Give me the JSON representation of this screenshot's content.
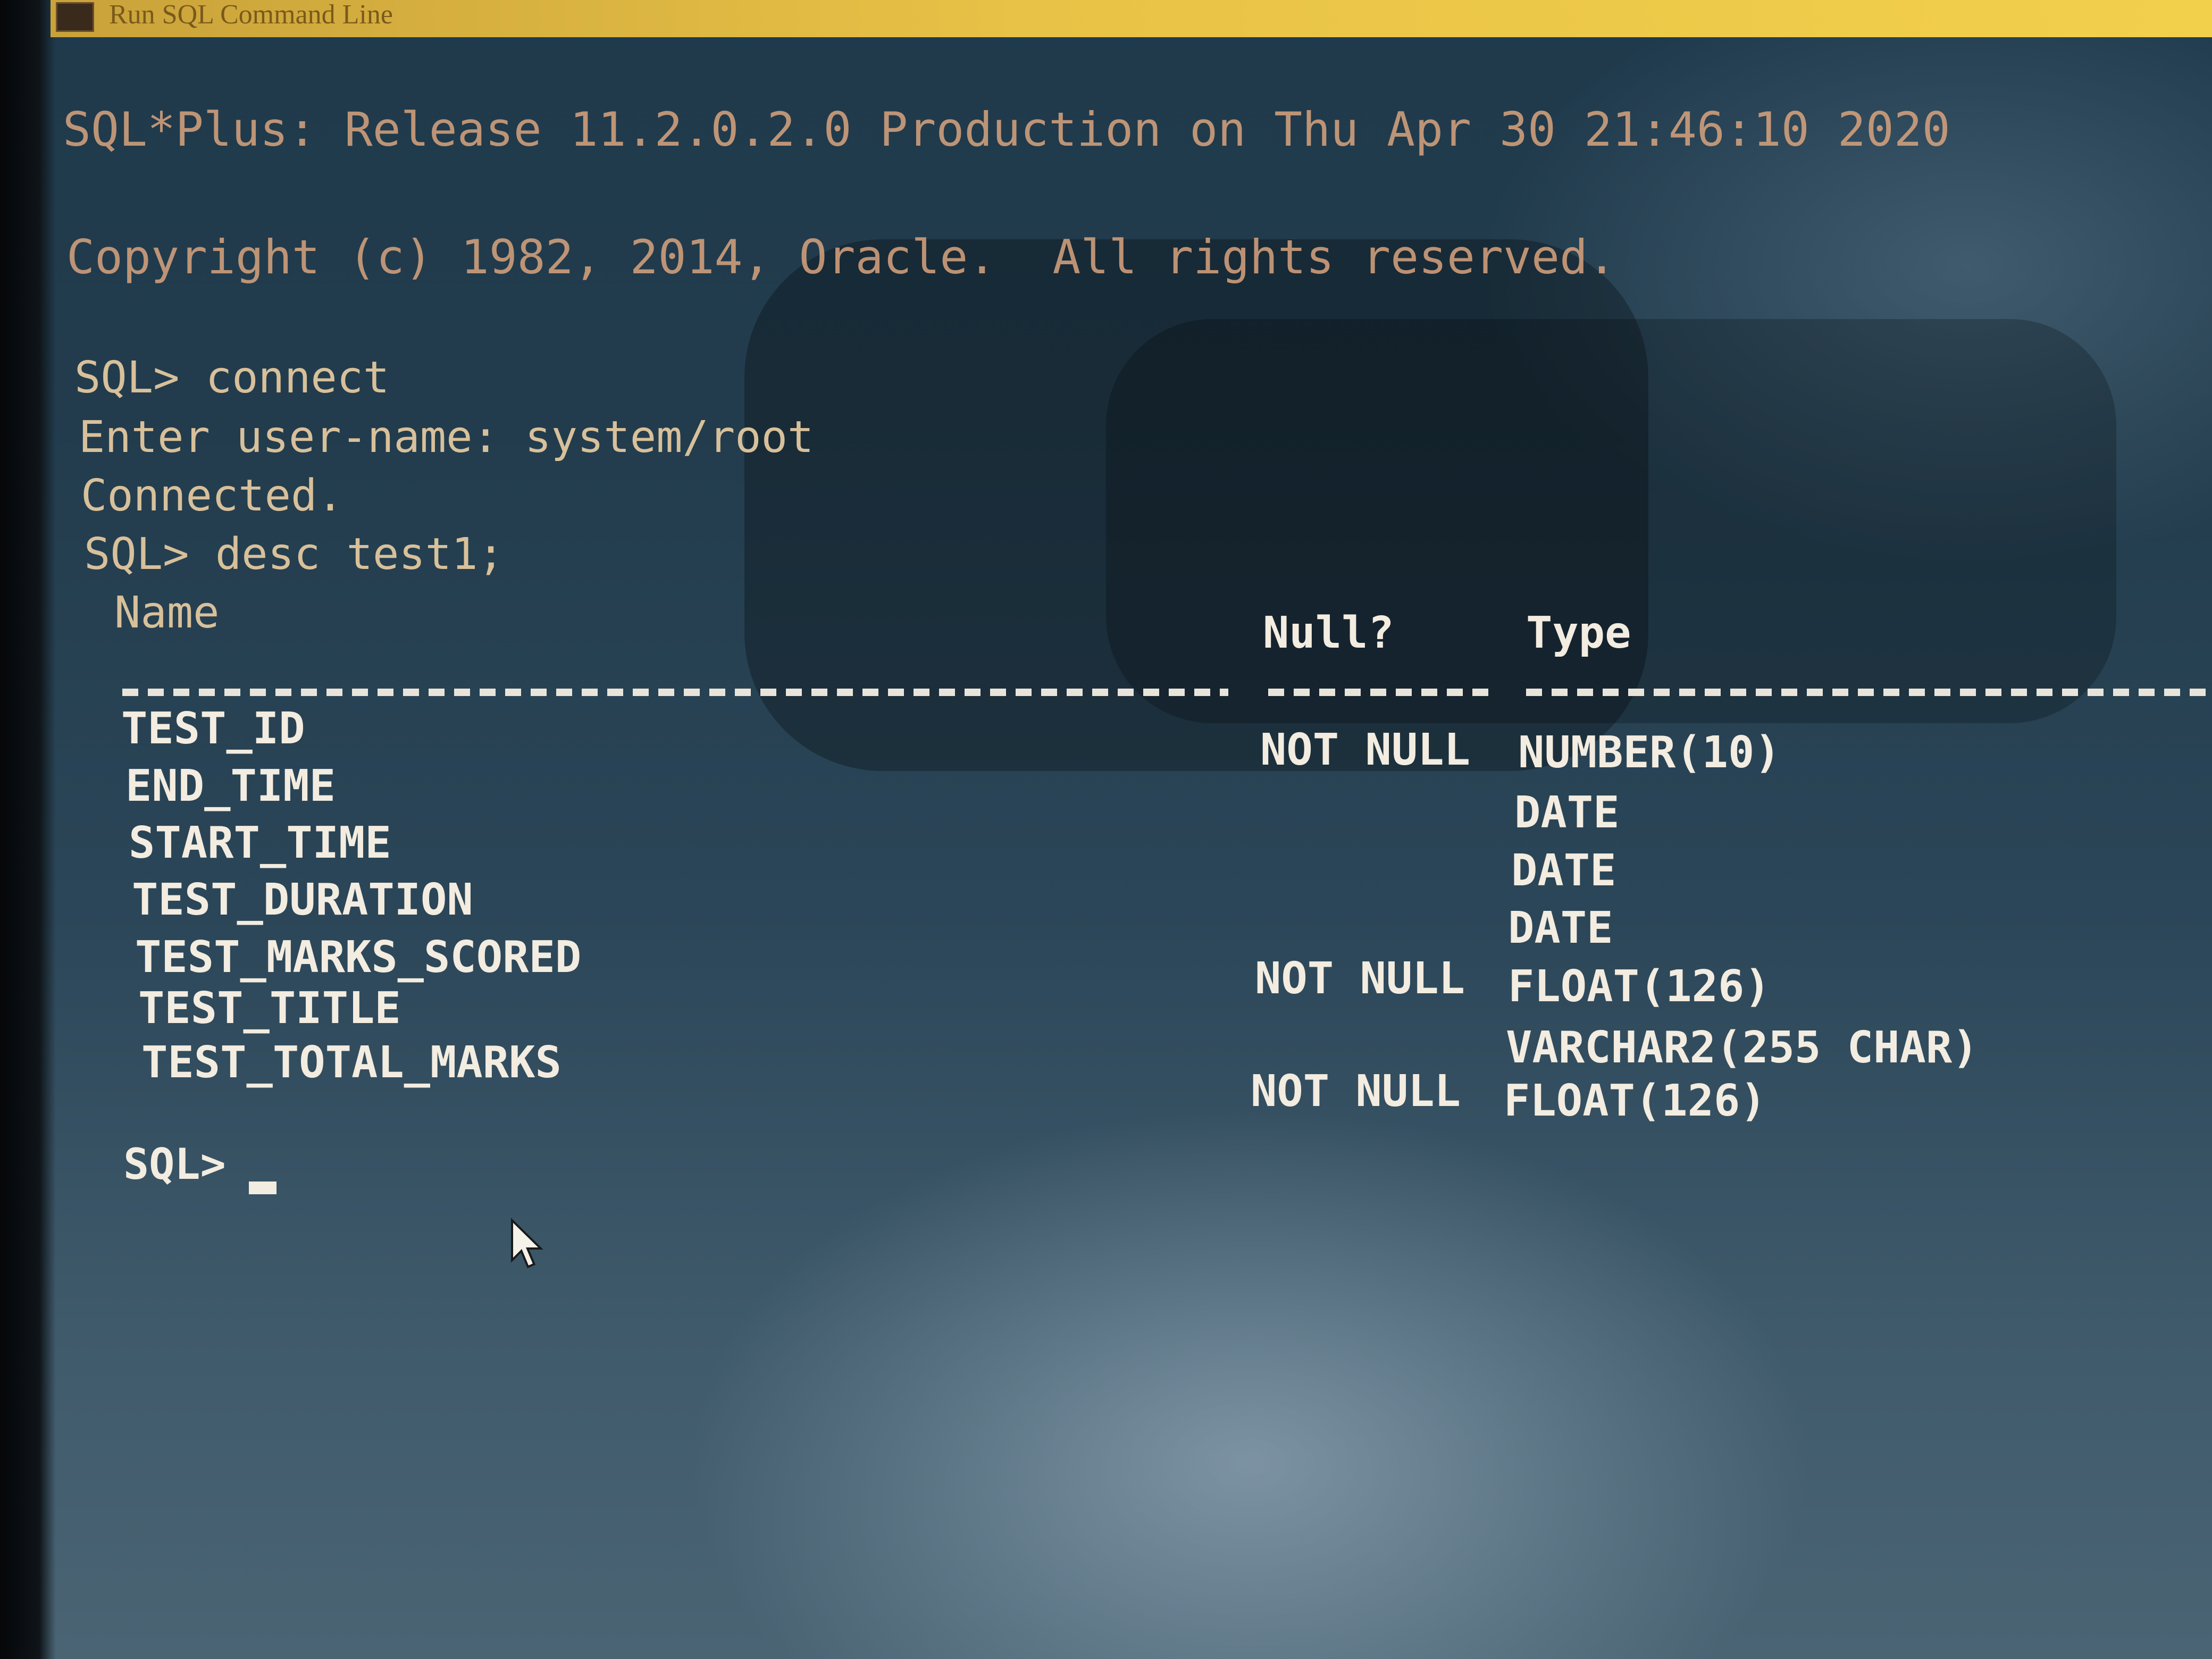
{
  "window": {
    "title": "Run SQL Command Line",
    "icon": "sql-app-icon"
  },
  "banner": {
    "release_line": "SQL*Plus: Release 11.2.0.2.0 Production on Thu Apr 30 21:46:10 2020",
    "copyright_line": "Copyright (c) 1982, 2014, Oracle.  All rights reserved."
  },
  "session": {
    "cmd_connect": "SQL> connect",
    "prompt_username": "Enter user-name: system/root",
    "connected_msg": "Connected.",
    "cmd_desc": "SQL> desc test1;"
  },
  "describe": {
    "headers": {
      "name": "Name",
      "null": "Null?",
      "type": "Type"
    },
    "rows": [
      {
        "name": "TEST_ID",
        "null": "NOT NULL",
        "type": "NUMBER(10)"
      },
      {
        "name": "END_TIME",
        "null": "",
        "type": "DATE"
      },
      {
        "name": "START_TIME",
        "null": "",
        "type": "DATE"
      },
      {
        "name": "TEST_DURATION",
        "null": "",
        "type": "DATE"
      },
      {
        "name": "TEST_MARKS_SCORED",
        "null": "NOT NULL",
        "type": "FLOAT(126)"
      },
      {
        "name": "TEST_TITLE",
        "null": "",
        "type": "VARCHAR2(255 CHAR)"
      },
      {
        "name": "TEST_TOTAL_MARKS",
        "null": "NOT NULL",
        "type": "FLOAT(126)"
      }
    ]
  },
  "final_prompt": "SQL>",
  "icons": {
    "cursor": "text-cursor-icon",
    "pointer": "mouse-pointer-icon"
  }
}
